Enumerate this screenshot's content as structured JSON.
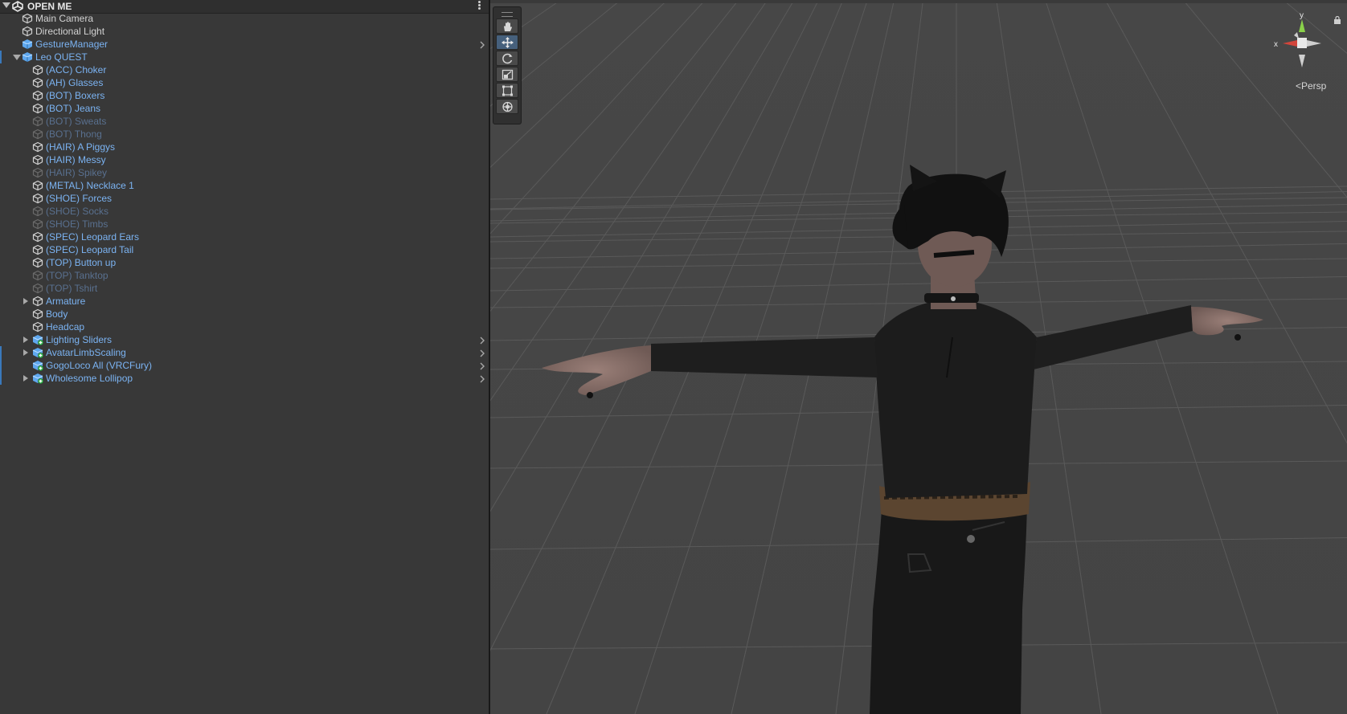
{
  "hierarchy": {
    "scene_title": "OPEN ME",
    "items": [
      {
        "label": "Main Camera",
        "depth": 0,
        "fold": "none",
        "icon": "gameobject-icon",
        "style": "white",
        "chevron": false,
        "marker": false
      },
      {
        "label": "Directional Light",
        "depth": 0,
        "fold": "none",
        "icon": "gameobject-icon",
        "style": "white",
        "chevron": false,
        "marker": false
      },
      {
        "label": "GestureManager",
        "depth": 0,
        "fold": "none",
        "icon": "prefab-icon",
        "style": "blue",
        "chevron": true,
        "marker": false
      },
      {
        "label": "Leo QUEST",
        "depth": 0,
        "fold": "expanded",
        "icon": "prefab-icon",
        "style": "blue",
        "chevron": false,
        "marker": true
      },
      {
        "label": "(ACC) Choker",
        "depth": 1,
        "fold": "none",
        "icon": "gameobject-icon",
        "style": "blue",
        "chevron": false,
        "marker": false
      },
      {
        "label": "(AH) Glasses",
        "depth": 1,
        "fold": "none",
        "icon": "gameobject-icon",
        "style": "blue",
        "chevron": false,
        "marker": false
      },
      {
        "label": "(BOT) Boxers",
        "depth": 1,
        "fold": "none",
        "icon": "gameobject-icon",
        "style": "blue",
        "chevron": false,
        "marker": false
      },
      {
        "label": "(BOT) Jeans",
        "depth": 1,
        "fold": "none",
        "icon": "gameobject-icon",
        "style": "blue",
        "chevron": false,
        "marker": false
      },
      {
        "label": "(BOT) Sweats",
        "depth": 1,
        "fold": "none",
        "icon": "gameobject-icon",
        "style": "blue-dim",
        "chevron": false,
        "marker": false
      },
      {
        "label": "(BOT) Thong",
        "depth": 1,
        "fold": "none",
        "icon": "gameobject-icon",
        "style": "blue-dim",
        "chevron": false,
        "marker": false
      },
      {
        "label": "(HAIR) A Piggys",
        "depth": 1,
        "fold": "none",
        "icon": "gameobject-icon",
        "style": "blue",
        "chevron": false,
        "marker": false
      },
      {
        "label": "(HAIR) Messy",
        "depth": 1,
        "fold": "none",
        "icon": "gameobject-icon",
        "style": "blue",
        "chevron": false,
        "marker": false
      },
      {
        "label": "(HAIR) Spikey",
        "depth": 1,
        "fold": "none",
        "icon": "gameobject-icon",
        "style": "blue-dim",
        "chevron": false,
        "marker": false
      },
      {
        "label": "(METAL) Necklace 1",
        "depth": 1,
        "fold": "none",
        "icon": "gameobject-icon",
        "style": "blue",
        "chevron": false,
        "marker": false
      },
      {
        "label": "(SHOE) Forces",
        "depth": 1,
        "fold": "none",
        "icon": "gameobject-icon",
        "style": "blue",
        "chevron": false,
        "marker": false
      },
      {
        "label": "(SHOE) Socks",
        "depth": 1,
        "fold": "none",
        "icon": "gameobject-icon",
        "style": "blue-dim",
        "chevron": false,
        "marker": false
      },
      {
        "label": "(SHOE) Timbs",
        "depth": 1,
        "fold": "none",
        "icon": "gameobject-icon",
        "style": "blue-dim",
        "chevron": false,
        "marker": false
      },
      {
        "label": "(SPEC) Leopard Ears",
        "depth": 1,
        "fold": "none",
        "icon": "gameobject-icon",
        "style": "blue",
        "chevron": false,
        "marker": false
      },
      {
        "label": "(SPEC) Leopard Tail",
        "depth": 1,
        "fold": "none",
        "icon": "gameobject-icon",
        "style": "blue",
        "chevron": false,
        "marker": false
      },
      {
        "label": "(TOP) Button up",
        "depth": 1,
        "fold": "none",
        "icon": "gameobject-icon",
        "style": "blue",
        "chevron": false,
        "marker": false
      },
      {
        "label": "(TOP) Tanktop",
        "depth": 1,
        "fold": "none",
        "icon": "gameobject-icon",
        "style": "blue-dim",
        "chevron": false,
        "marker": false
      },
      {
        "label": "(TOP) Tshirt",
        "depth": 1,
        "fold": "none",
        "icon": "gameobject-icon",
        "style": "blue-dim",
        "chevron": false,
        "marker": false
      },
      {
        "label": "Armature",
        "depth": 1,
        "fold": "collapsed",
        "icon": "gameobject-icon",
        "style": "blue",
        "chevron": false,
        "marker": false
      },
      {
        "label": "Body",
        "depth": 1,
        "fold": "none",
        "icon": "gameobject-icon",
        "style": "blue",
        "chevron": false,
        "marker": false
      },
      {
        "label": "Headcap",
        "depth": 1,
        "fold": "none",
        "icon": "gameobject-icon",
        "style": "blue",
        "chevron": false,
        "marker": false
      },
      {
        "label": "Lighting Sliders",
        "depth": 1,
        "fold": "collapsed",
        "icon": "prefab-variant-icon",
        "style": "blue",
        "chevron": true,
        "marker": false
      },
      {
        "label": "AvatarLimbScaling",
        "depth": 1,
        "fold": "collapsed",
        "icon": "prefab-variant-icon",
        "style": "blue",
        "chevron": true,
        "marker": true
      },
      {
        "label": "GogoLoco All (VRCFury)",
        "depth": 1,
        "fold": "none",
        "icon": "prefab-variant-icon",
        "style": "blue",
        "chevron": true,
        "marker": true
      },
      {
        "label": "Wholesome Lollipop",
        "depth": 1,
        "fold": "collapsed",
        "icon": "prefab-variant-icon",
        "style": "blue",
        "chevron": true,
        "marker": true
      }
    ]
  },
  "scene": {
    "tools": [
      {
        "name": "hand-tool-icon",
        "active": false
      },
      {
        "name": "move-tool-icon",
        "active": true
      },
      {
        "name": "rotate-tool-icon",
        "active": false
      },
      {
        "name": "scale-tool-icon",
        "active": false
      },
      {
        "name": "rect-tool-icon",
        "active": false
      },
      {
        "name": "transform-tool-icon",
        "active": false
      }
    ],
    "gizmo": {
      "y_label": "y",
      "x_label": "x",
      "projection": "<Persp"
    },
    "colors": {
      "axis_y": "#8ad14a",
      "axis_x": "#d2453b",
      "prefab_blue": "#7bb3f2",
      "selection_marker": "#3a79bb"
    }
  }
}
